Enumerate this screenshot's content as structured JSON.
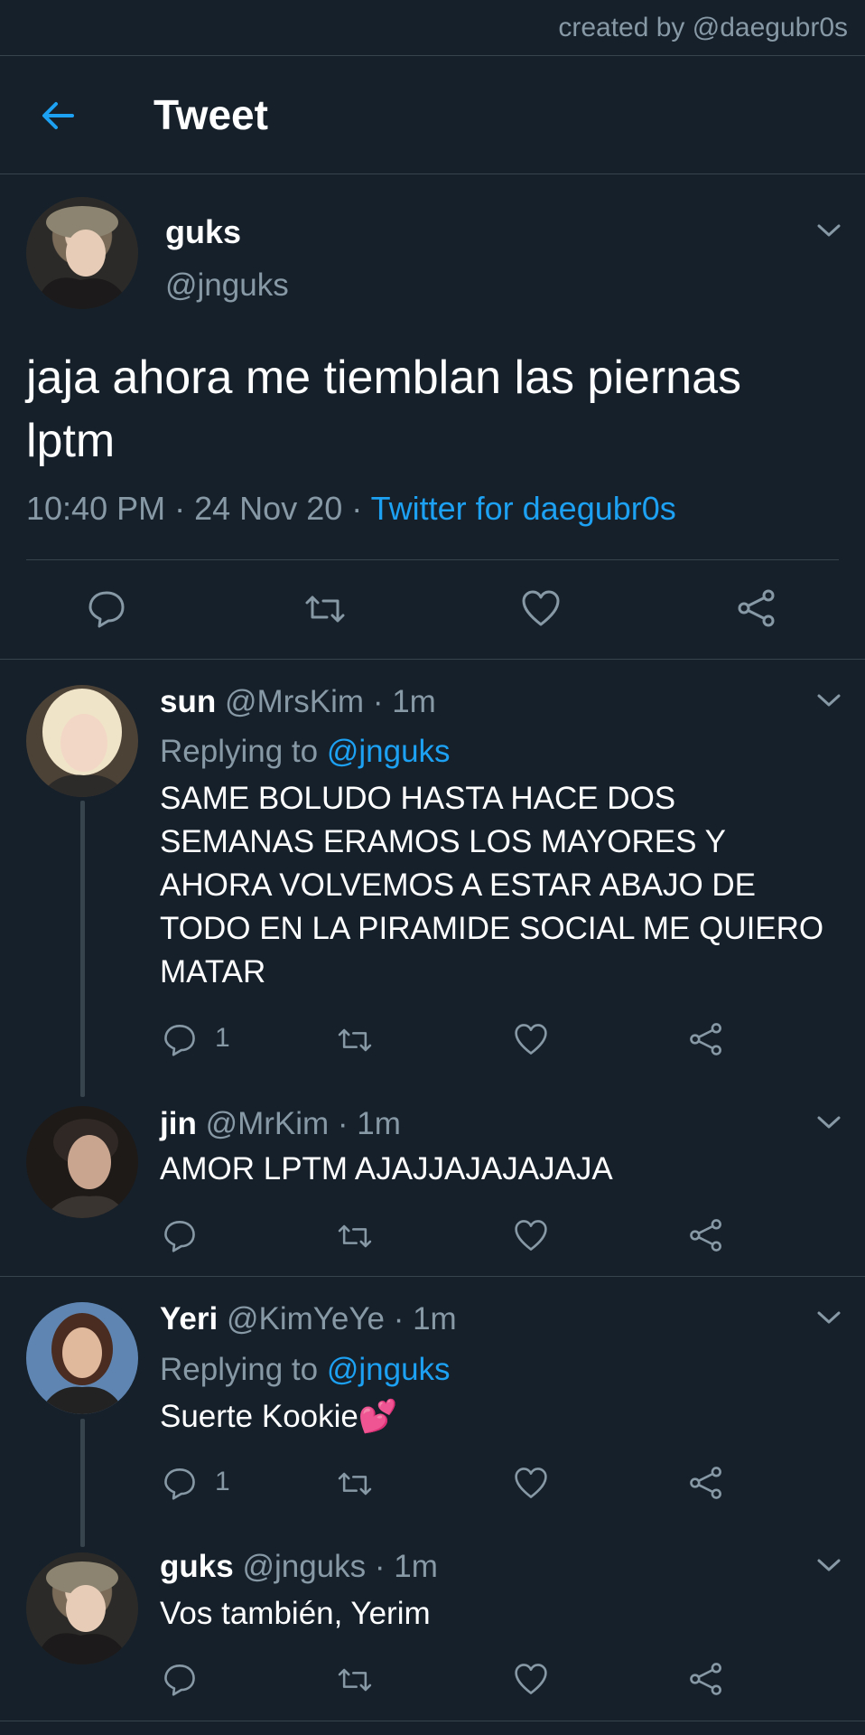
{
  "credit": "created by @daegubr0s",
  "header": {
    "title": "Tweet"
  },
  "main_tweet": {
    "name": "guks",
    "handle": "@jnguks",
    "text_line1": "jaja ahora me tiemblan las piernas",
    "text_line2": "lptm",
    "time": "10:40 PM",
    "date": "24 Nov 20",
    "source": "Twitter for daegubr0s",
    "sep": "·"
  },
  "replies": [
    {
      "name": "sun",
      "handle": "@MrsKim",
      "ago": "· 1m",
      "replying_prefix": "Replying to",
      "replying_to": "@jnguks",
      "lines": [
        "SAME BOLUDO HASTA HACE DOS",
        "SEMANAS ERAMOS LOS MAYORES Y",
        "AHORA VOLVEMOS A ESTAR ABAJO DE",
        "TODO EN LA PIRAMIDE SOCIAL ME QUIERO",
        "MATAR"
      ],
      "reply_count": "1"
    },
    {
      "name": "jin",
      "handle": "@MrKim",
      "ago": "· 1m",
      "lines": [
        "AMOR LPTM AJAJJAJAJAJAJA"
      ]
    },
    {
      "name": "Yeri",
      "handle": "@KimYeYe",
      "ago": "· 1m",
      "replying_prefix": "Replying to",
      "replying_to": "@jnguks",
      "lines": [
        "Suerte Kookie"
      ],
      "emoji": "💕",
      "reply_count": "1"
    },
    {
      "name": "guks",
      "handle": "@jnguks",
      "ago": "· 1m",
      "lines": [
        "Vos también, Yerim"
      ]
    }
  ],
  "icons": {
    "back": "arrow-left-icon",
    "more": "chevron-down-icon",
    "reply": "comment-icon",
    "retweet": "retweet-icon",
    "like": "heart-icon",
    "share": "share-icon"
  },
  "colors": {
    "background": "#15202b",
    "divider": "#38444d",
    "secondary_text": "#8899a6",
    "accent": "#1da1f2"
  }
}
